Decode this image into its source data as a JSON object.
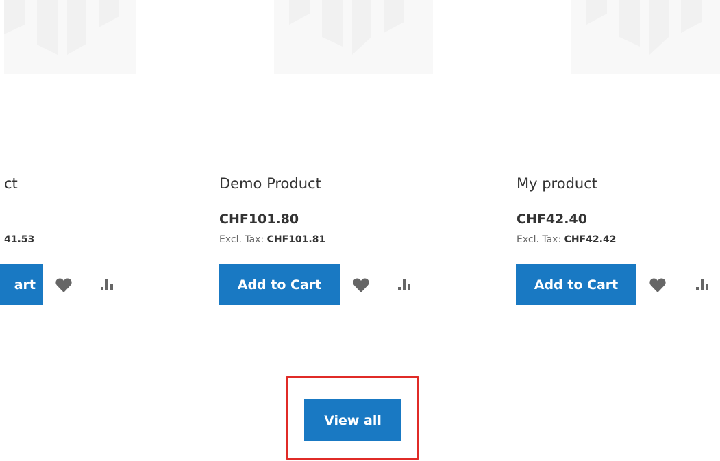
{
  "products": [
    {
      "name": "ct",
      "price": "",
      "excl_tax_label": "",
      "excl_tax_value": "41.53",
      "add_to_cart_label": "art",
      "wishlist_icon": "heart-icon",
      "compare_icon": "bar-chart-icon"
    },
    {
      "name": "Demo Product",
      "price": "CHF101.80",
      "excl_tax_label": "Excl. Tax: ",
      "excl_tax_value": "CHF101.81",
      "add_to_cart_label": "Add to Cart",
      "wishlist_icon": "heart-icon",
      "compare_icon": "bar-chart-icon"
    },
    {
      "name": "My product",
      "price": "CHF42.40",
      "excl_tax_label": "Excl. Tax: ",
      "excl_tax_value": "CHF42.42",
      "add_to_cart_label": "Add to Cart",
      "wishlist_icon": "heart-icon",
      "compare_icon": "bar-chart-icon"
    }
  ],
  "view_all": {
    "label": "View all",
    "highlight_color": "#e02b27"
  },
  "colors": {
    "primary_button": "#1979c3",
    "icon": "#666666",
    "image_placeholder": "#f8f8f8"
  }
}
